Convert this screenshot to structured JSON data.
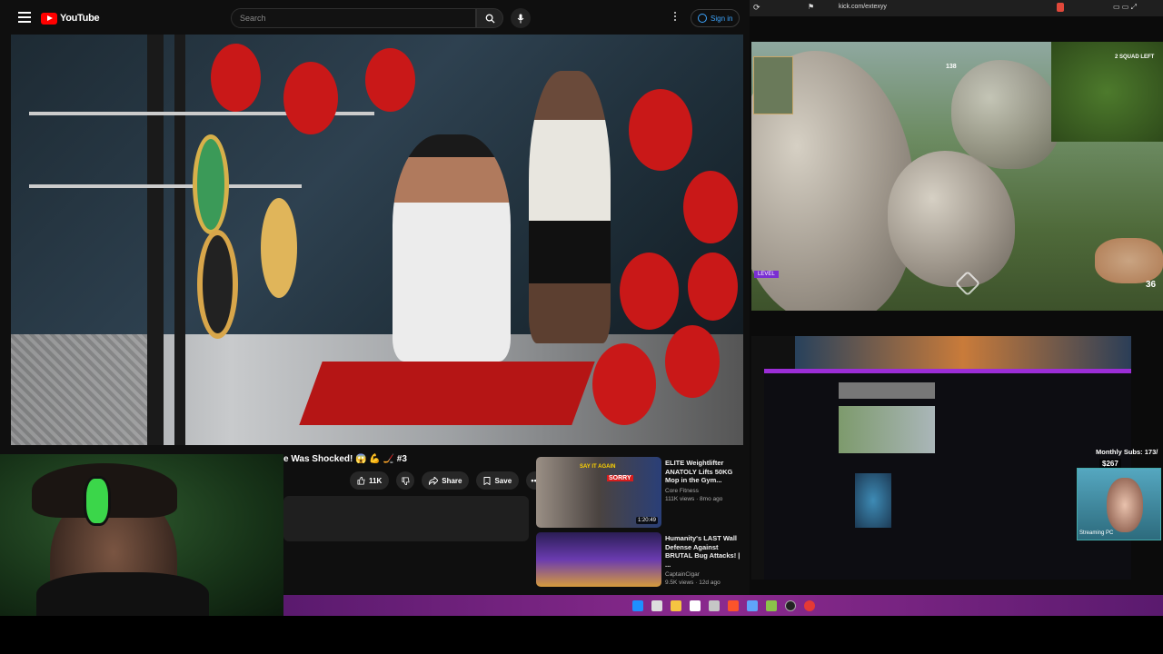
{
  "youtube": {
    "logo": "YouTube",
    "search_placeholder": "Search",
    "sign_in": "Sign in",
    "video_title": "e Was Shocked! 😱 💪 🏒 #3",
    "like_count": "11K",
    "share_label": "Share",
    "save_label": "Save",
    "recommendations": [
      {
        "title": "ELITE Weightlifter ANATOLY Lifts 50KG Mop in the Gym...",
        "channel": "Core Fitness",
        "meta": "111K views · 8mo ago",
        "duration": "1:20:49",
        "thumb_text": "SAY IT AGAIN",
        "thumb_text2": "SORRY"
      },
      {
        "title": "Humanity's LAST Wall Defense Against BRUTAL Bug Attacks! | ...",
        "channel": "CaptainCigar",
        "meta": "9.5K views · 12d ago"
      }
    ]
  },
  "browser": {
    "url": "kick.com/extexyy",
    "game_hud": {
      "squad_left": "2 SQUAD LEFT",
      "kills": "36",
      "compass": "138",
      "level": "LEVEL"
    },
    "second_stream": {
      "monthly_subs": "Monthly Subs: 173/",
      "sub_count": "$267",
      "streaming_pc": "Streaming PC"
    }
  },
  "colors": {
    "yt_bg": "#0f0f0f",
    "yt_red": "#ff0000",
    "link_blue": "#3ea6ff",
    "taskbar": "#8b2a8e"
  }
}
